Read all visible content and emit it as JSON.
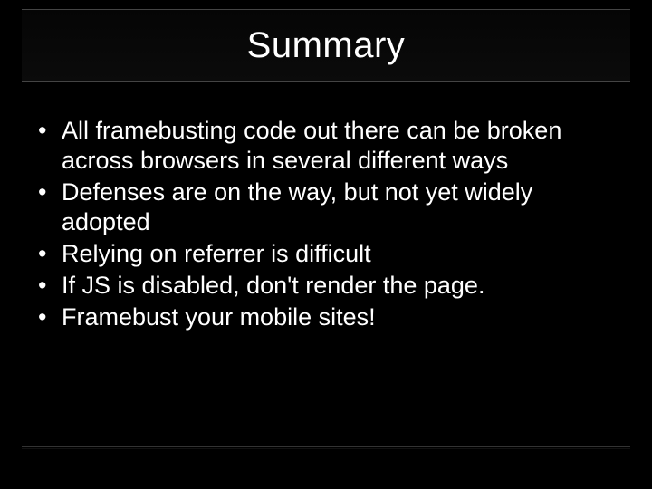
{
  "title": "Summary",
  "bullets": [
    "All framebusting code out there can be broken across browsers in several different ways",
    "Defenses are on the way, but not yet widely adopted",
    "Relying on referrer is difficult",
    "If JS is disabled, don't render the page.",
    "Framebust your mobile sites!"
  ]
}
